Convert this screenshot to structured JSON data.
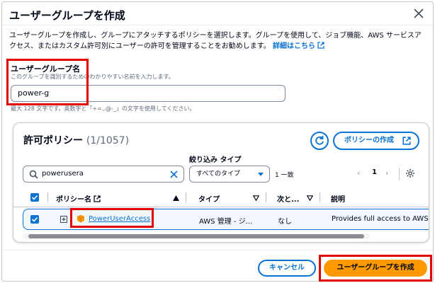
{
  "dialog": {
    "title": "ユーザーグループを作成",
    "description": "ユーザーグループを作成し、グループにアタッチするポリシーを選択します。グループを使用して、ジョブ機能、AWS サービスアクセス、またはカスタム許可別にユーザーの許可を管理することをお勧めします。",
    "learn_more": "詳細はこちら"
  },
  "group_name": {
    "label": "ユーザーグループ名",
    "hint": "このグループを識別するためのわかりやすい名前を入力します。",
    "value": "power-g",
    "constraint": "最大 128 文字です。英数字と「+=,.@-_」の文字を使用してください。"
  },
  "policies": {
    "title": "許可ポリシー",
    "count": "(1/1057)",
    "create_label": "ポリシーの作成",
    "filter_label": "絞り込み タイプ",
    "search_value": "powerusera",
    "type_select": "すべてのタイプ",
    "match_count": "1 一致",
    "page_prev": "‹",
    "page": "1",
    "page_next": "›",
    "columns": [
      "ポリシー名",
      "タイプ",
      "次と...",
      "説明"
    ],
    "rows": [
      {
        "name": "PowerUserAccess",
        "type": "AWS 管理 - ジ...",
        "attached": "なし",
        "description": "Provides full access to AWS se"
      }
    ]
  },
  "footer": {
    "cancel": "キャンセル",
    "create": "ユーザーグループを作成"
  },
  "colors": {
    "primary": "#0972d3",
    "accent": "#ff9900",
    "highlight": "#e30000"
  },
  "icons": [
    "close-icon",
    "external-link-icon",
    "refresh-icon",
    "search-icon",
    "clear-icon",
    "settings-icon",
    "sort-asc-icon",
    "sort-desc-icon",
    "expand-icon",
    "aws-policy-icon",
    "check-icon"
  ]
}
